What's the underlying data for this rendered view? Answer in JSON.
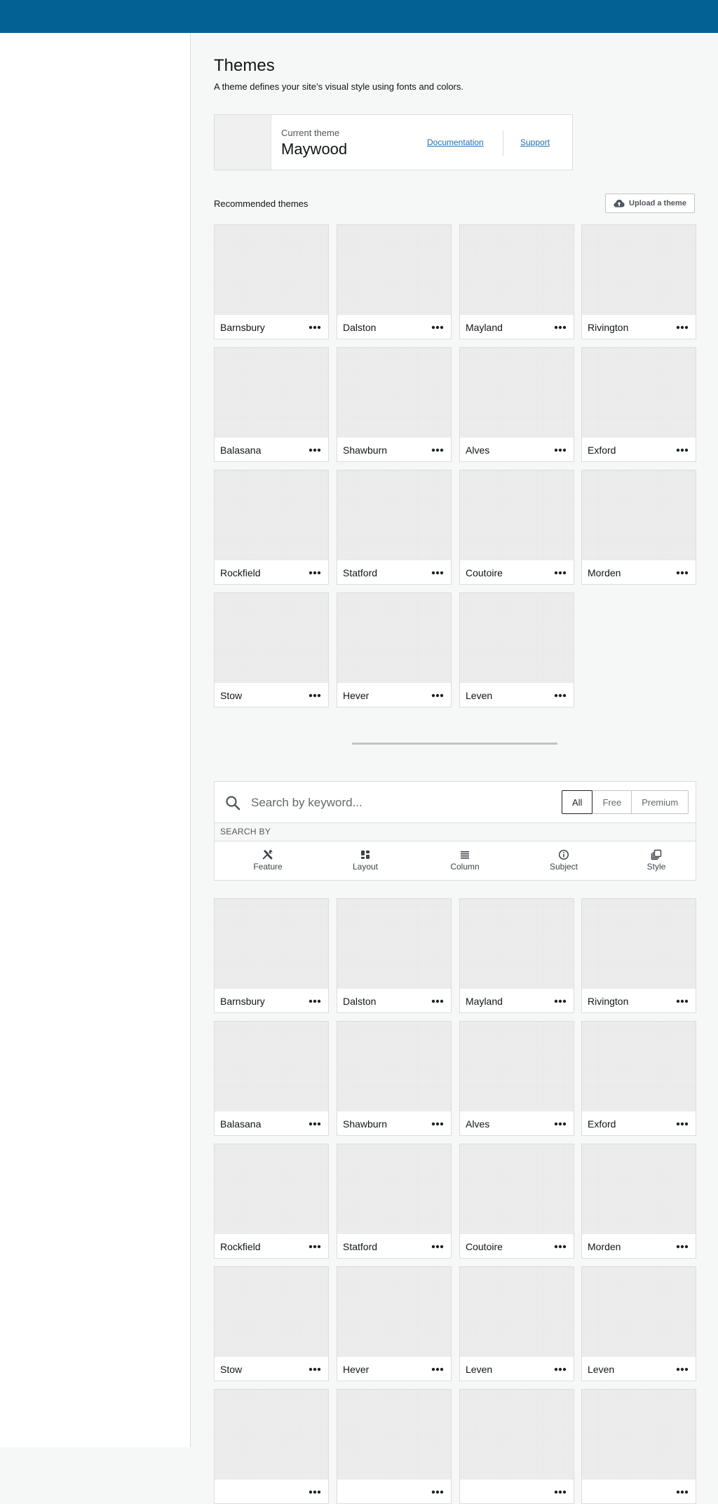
{
  "page": {
    "title": "Themes",
    "subtitle": "A theme defines your site’s visual style using fonts and colors."
  },
  "current_theme": {
    "label": "Current theme",
    "name": "Maywood",
    "documentation_link": "Documentation",
    "support_link": "Support"
  },
  "recommended": {
    "title": "Recommended themes",
    "upload_label": "Upload a theme",
    "themes": [
      "Barnsbury",
      "Dalston",
      "Mayland",
      "Rivington",
      "Balasana",
      "Shawburn",
      "Alves",
      "Exford",
      "Rockfield",
      "Statford",
      "Coutoire",
      "Morden",
      "Stow",
      "Hever",
      "Leven"
    ]
  },
  "search": {
    "placeholder": "Search by keyword...",
    "tiers": [
      "All",
      "Free",
      "Premium"
    ],
    "active_tier": "All",
    "search_by_label": "SEARCH BY",
    "filters": [
      {
        "label": "Feature",
        "icon": "tools-icon"
      },
      {
        "label": "Layout",
        "icon": "layout-icon"
      },
      {
        "label": "Column",
        "icon": "column-icon"
      },
      {
        "label": "Subject",
        "icon": "info-icon"
      },
      {
        "label": "Style",
        "icon": "style-icon"
      }
    ]
  },
  "all_themes": {
    "themes": [
      "Barnsbury",
      "Dalston",
      "Mayland",
      "Rivington",
      "Balasana",
      "Shawburn",
      "Alves",
      "Exford",
      "Rockfield",
      "Statford",
      "Coutoire",
      "Morden",
      "Stow",
      "Hever",
      "Leven",
      "Leven",
      "",
      "",
      "",
      ""
    ]
  },
  "colors": {
    "topbar": "#036291",
    "link": "#2271b1"
  }
}
